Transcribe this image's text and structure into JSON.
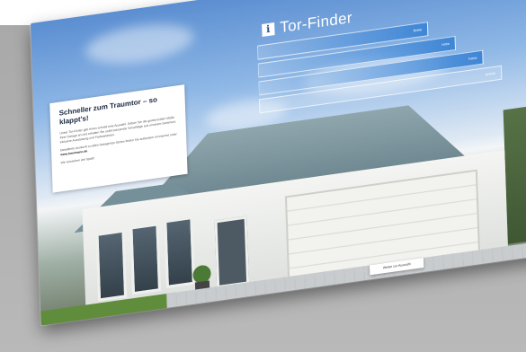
{
  "finder": {
    "title": "Tor-Finder",
    "logo_letter": "i",
    "fields": [
      "Breite",
      "Höhe",
      "Farbe",
      "Antrieb"
    ]
  },
  "info": {
    "title": "Schneller zum Traumtor – so klappt's!",
    "body1": "Unser Tor-Finder gibt Ihnen schnell eine Auswahl. Geben Sie die gewünschten Maße Ihrer Garage an und erhalten Sie sofort passende Vorschläge aus unserem Sortiment, inklusive Ausstattung und Farbvarianten.",
    "body2": "Detaillierte Auskunft zu allen Garagentor-Serien finden Sie außerdem im Internet unter",
    "link": "www.hoermann.de",
    "body3": "Wir wünschen viel Spaß!"
  },
  "cta": {
    "label": "Weiter zur Auswahl"
  }
}
